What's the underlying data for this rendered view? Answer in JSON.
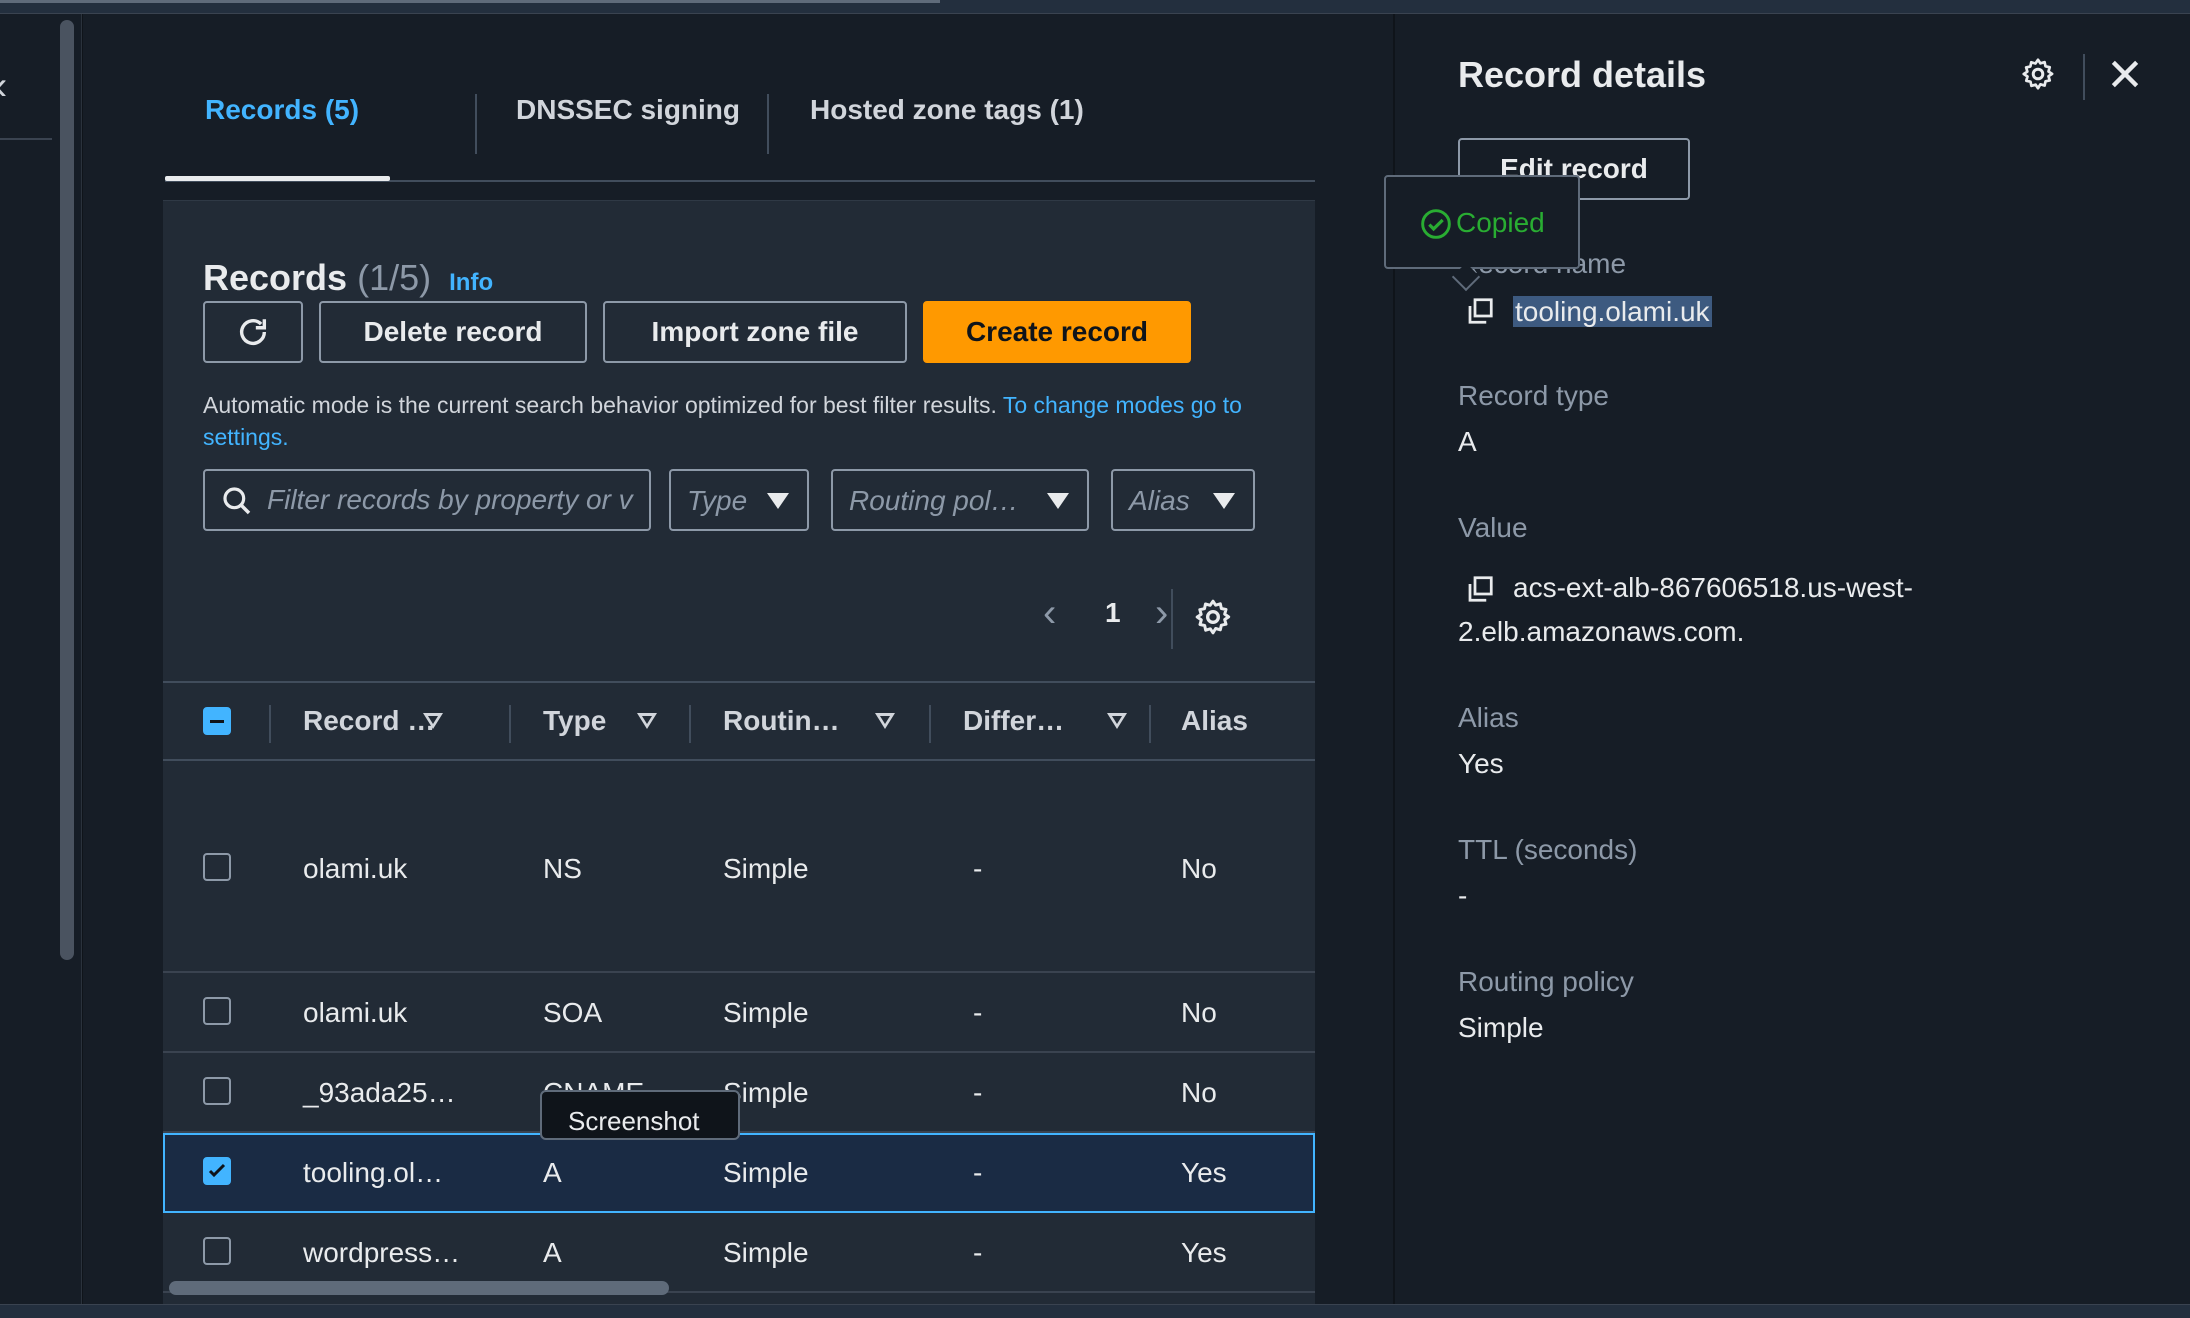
{
  "tabs": [
    {
      "label": "Records (5)"
    },
    {
      "label": "DNSSEC signing"
    },
    {
      "label": "Hosted zone tags (1)"
    }
  ],
  "records_panel": {
    "title": "Records",
    "count": "(1/5)",
    "info": "Info",
    "buttons": {
      "delete": "Delete record",
      "import": "Import zone file",
      "create": "Create record"
    },
    "help_text": "Automatic mode is the current search behavior optimized for best filter results.",
    "help_link": "To change modes go to settings.",
    "search_placeholder": "Filter records by property or v",
    "filters": {
      "type": "Type",
      "routing": "Routing pol…",
      "alias": "Alias"
    },
    "page": "1"
  },
  "table": {
    "columns": [
      "Record …",
      "Type",
      "Routin…",
      "Differ…",
      "Alias"
    ],
    "rows": [
      {
        "name": "olami.uk",
        "type": "NS",
        "routing": "Simple",
        "differ": "-",
        "alias": "No",
        "checked": false
      },
      {
        "name": "olami.uk",
        "type": "SOA",
        "routing": "Simple",
        "differ": "-",
        "alias": "No",
        "checked": false
      },
      {
        "name": "_93ada25…",
        "type": "CNAME",
        "routing": "Simple",
        "differ": "-",
        "alias": "No",
        "checked": false
      },
      {
        "name": "tooling.ol…",
        "type": "A",
        "routing": "Simple",
        "differ": "-",
        "alias": "Yes",
        "checked": true
      },
      {
        "name": "wordpress…",
        "type": "A",
        "routing": "Simple",
        "differ": "-",
        "alias": "Yes",
        "checked": false
      }
    ]
  },
  "tooltip_screenshot": "Screenshot",
  "details": {
    "title": "Record details",
    "edit_button": "Edit record",
    "copied": "Copied",
    "record_name_label": "Record name",
    "record_name": "tooling.olami.uk",
    "record_type_label": "Record type",
    "record_type": "A",
    "value_label": "Value",
    "value_line1": "acs-ext-alb-867606518.us-west-",
    "value_line2": "2.elb.amazonaws.com.",
    "alias_label": "Alias",
    "alias": "Yes",
    "ttl_label": "TTL (seconds)",
    "ttl": "-",
    "routing_label": "Routing policy",
    "routing": "Simple"
  },
  "colors": {
    "accent": "#42b4ff",
    "primary_button": "#ff9900",
    "success": "#29ad32",
    "background": "#161d26"
  }
}
